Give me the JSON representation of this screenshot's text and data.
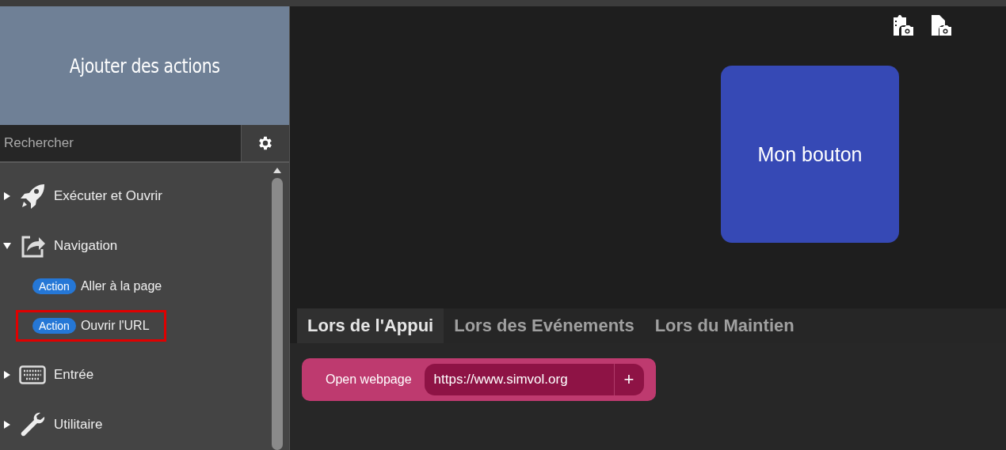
{
  "panel": {
    "title": "Ajouter des actions",
    "search": {
      "placeholder": "Rechercher"
    }
  },
  "categories": [
    {
      "kind": "rocket",
      "label": "Exécuter et Ouvrir",
      "expanded": false
    },
    {
      "kind": "share",
      "label": "Navigation",
      "expanded": true,
      "children": [
        {
          "badge": "Action",
          "label": "Aller à la page",
          "selected": false
        },
        {
          "badge": "Action",
          "label": "Ouvrir l'URL",
          "selected": true
        }
      ]
    },
    {
      "kind": "keyboard",
      "label": "Entrée",
      "expanded": false
    },
    {
      "kind": "wrench",
      "label": "Utilitaire",
      "expanded": false
    }
  ],
  "button": {
    "label": "Mon bouton"
  },
  "tabs": [
    {
      "label": "Lors de l'Appui",
      "selected": true
    },
    {
      "label": "Lors des Evénements",
      "selected": false
    },
    {
      "label": "Lors du Maintien",
      "selected": false
    }
  ],
  "action": {
    "label": "Open webpage",
    "value": "https://www.simvol.org",
    "add": "+"
  }
}
